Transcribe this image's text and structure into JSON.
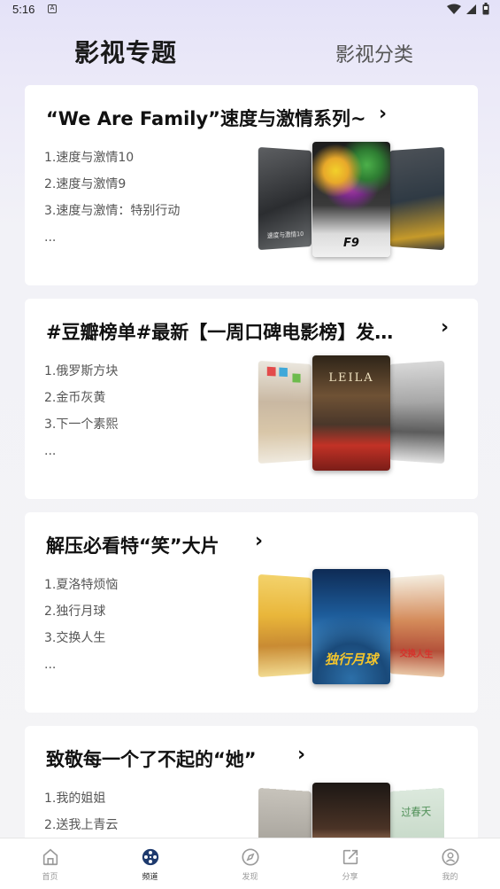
{
  "status_bar": {
    "time": "5:16",
    "notif_letter": "A"
  },
  "tabs": {
    "main": "影视专题",
    "second": "影视分类"
  },
  "cards": [
    {
      "title": "“We Are Family”速度与激情系列~",
      "arrow": "›",
      "items": [
        "1.速度与激情10",
        "2.速度与激情9",
        "3.速度与激情：特别行动",
        "..."
      ],
      "poster_labels": {
        "center": "F9",
        "left": "速度与激情10"
      }
    },
    {
      "title": "#豆瓣榜单#最新【一周口碑电影榜】发…",
      "arrow": "›",
      "items": [
        "1.俄罗斯方块",
        "2.金币灰黄",
        "3.下一个素熙",
        "..."
      ],
      "poster_labels": {
        "center": "LEILA"
      }
    },
    {
      "title": "解压必看特“笑”大片",
      "arrow": "›",
      "items": [
        "1.夏洛特烦恼",
        "2.独行月球",
        "3.交换人生",
        "..."
      ],
      "poster_labels": {
        "center": "独行月球",
        "right": "交换人生"
      }
    },
    {
      "title": "致敬每一个了不起的“她”",
      "arrow": "›",
      "items": [
        "1.我的姐姐",
        "2.送我上青云"
      ],
      "poster_labels": {
        "right": "过春天"
      }
    }
  ],
  "bottom_nav": [
    {
      "label": "首页",
      "icon": "home-icon",
      "active": false
    },
    {
      "label": "频道",
      "icon": "film-reel-icon",
      "active": true
    },
    {
      "label": "发现",
      "icon": "compass-icon",
      "active": false
    },
    {
      "label": "分享",
      "icon": "share-icon",
      "active": false
    },
    {
      "label": "我的",
      "icon": "profile-icon",
      "active": false
    }
  ],
  "colors": {
    "accent": "#1e3a6e",
    "background": "#f4f4f6",
    "card": "#ffffff"
  }
}
